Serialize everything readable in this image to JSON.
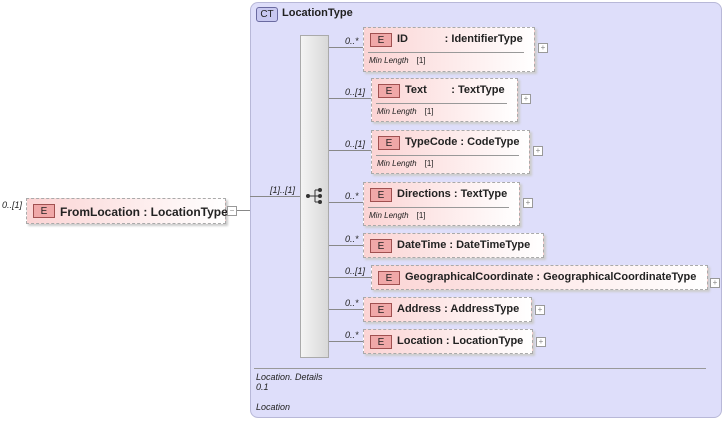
{
  "root": {
    "multiplicity": "0..[1]",
    "badge": "E",
    "name": "FromLocation",
    "type": "LocationType",
    "toggle": "−"
  },
  "complex_type": {
    "badge": "CT",
    "name": "LocationType",
    "sequence_multiplicity": "[1]..[1]",
    "footer": {
      "line1": "Location. Details",
      "line2": "0.1",
      "line3": "Location"
    }
  },
  "children": [
    {
      "multiplicity": "0..*",
      "badge": "E",
      "label": "ID            : IdentifierType",
      "facet": "Min Length",
      "facet_value": "[1]"
    },
    {
      "multiplicity": "0..[1]",
      "badge": "E",
      "label": "Text        : TextType",
      "facet": "Min Length",
      "facet_value": "[1]"
    },
    {
      "multiplicity": "0..[1]",
      "badge": "E",
      "label": "TypeCode : CodeType",
      "facet": "Min Length",
      "facet_value": "[1]"
    },
    {
      "multiplicity": "0..*",
      "badge": "E",
      "label": "Directions : TextType",
      "facet": "Min Length",
      "facet_value": "[1]"
    },
    {
      "multiplicity": "0..*",
      "badge": "E",
      "label": "DateTime : DateTimeType"
    },
    {
      "multiplicity": "0..[1]",
      "badge": "E",
      "label": "GeographicalCoordinate : GeographicalCoordinateType"
    },
    {
      "multiplicity": "0..*",
      "badge": "E",
      "label": "Address : AddressType"
    },
    {
      "multiplicity": "0..*",
      "badge": "E",
      "label": "Location : LocationType"
    }
  ],
  "expand_symbol": "+"
}
